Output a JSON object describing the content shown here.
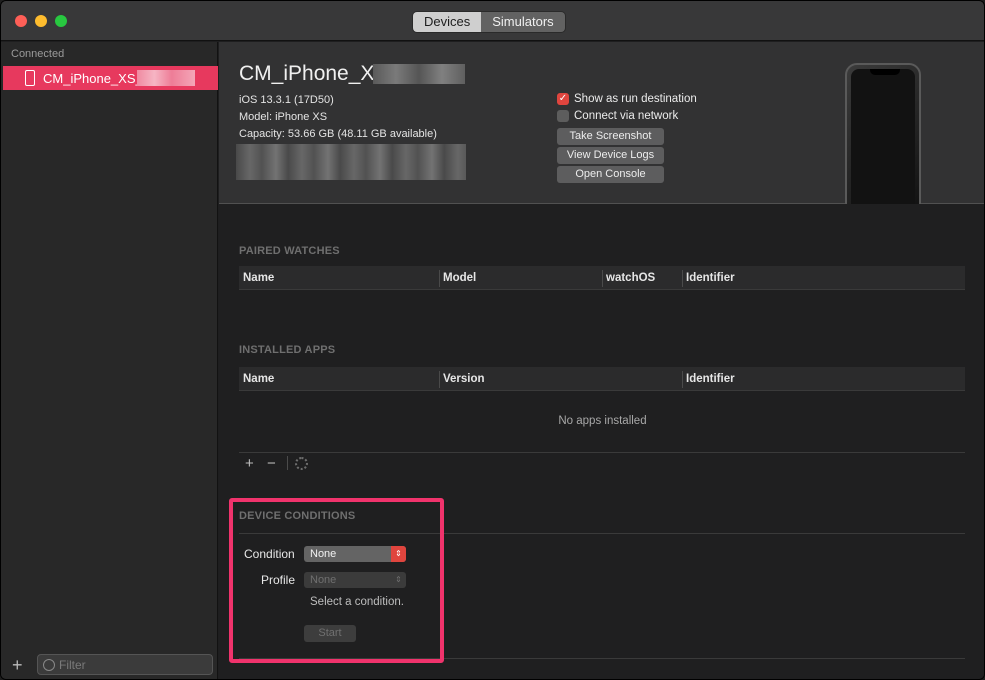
{
  "toolbar": {
    "tabs": [
      {
        "label": "Devices",
        "selected": true
      },
      {
        "label": "Simulators",
        "selected": false
      }
    ]
  },
  "sidebar": {
    "section_label": "Connected",
    "device_label": "CM_iPhone_XS_",
    "filter_placeholder": "Filter"
  },
  "device": {
    "name": "CM_iPhone_XS_",
    "ios": "iOS 13.3.1 (17D50)",
    "model": "Model: iPhone XS",
    "capacity": "Capacity: 53.66 GB (48.11 GB available)",
    "show_run_destination": "Show as run destination",
    "show_run_destination_checked": true,
    "connect_network": "Connect via network",
    "connect_network_checked": false,
    "take_screenshot": "Take Screenshot",
    "view_logs": "View Device Logs",
    "open_console": "Open Console"
  },
  "paired_watches": {
    "title": "PAIRED WATCHES",
    "columns": [
      "Name",
      "Model",
      "watchOS",
      "Identifier"
    ]
  },
  "installed_apps": {
    "title": "INSTALLED APPS",
    "columns": [
      "Name",
      "Version",
      "Identifier"
    ],
    "empty_text": "No apps installed"
  },
  "device_conditions": {
    "title": "DEVICE CONDITIONS",
    "condition_label": "Condition",
    "condition_value": "None",
    "profile_label": "Profile",
    "profile_value": "None",
    "hint": "Select a condition.",
    "start_label": "Start"
  },
  "colors": {
    "accent": "#e7395e",
    "highlight": "#f0336c",
    "checkbox": "#e0453e"
  }
}
